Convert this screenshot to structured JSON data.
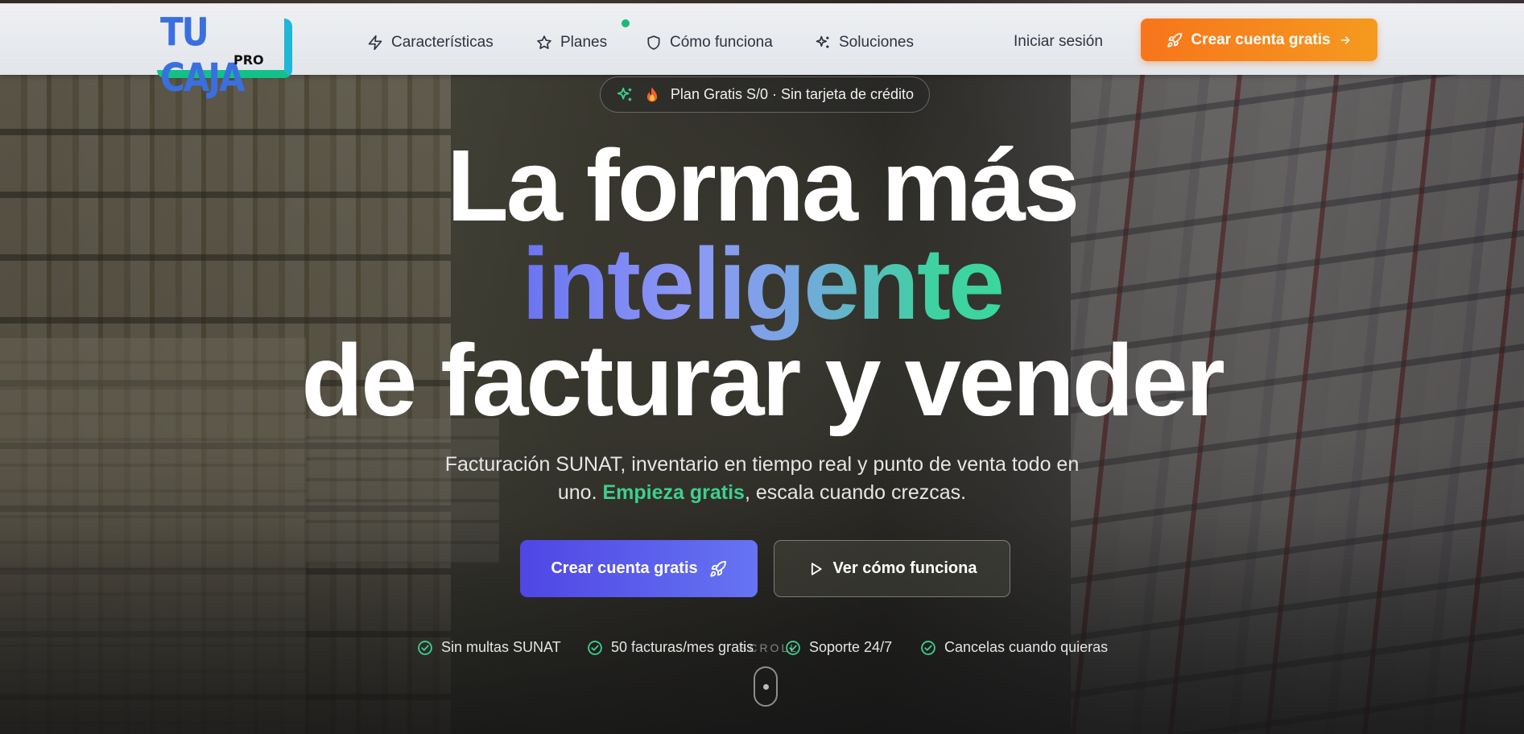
{
  "brand": {
    "logo_main": "TU CAJA",
    "logo_sub": "PRO",
    "colors": {
      "logo_blue": "#3a6fe0",
      "logo_cyan": "#1fb6d9",
      "logo_green": "#12c08a"
    }
  },
  "nav": {
    "items": [
      {
        "label": "Características",
        "icon": "zap-icon"
      },
      {
        "label": "Planes",
        "icon": "star-icon"
      },
      {
        "label": "Cómo funciona",
        "icon": "shield-icon"
      },
      {
        "label": "Soluciones",
        "icon": "sparkles-icon"
      }
    ],
    "login_label": "Iniciar sesión",
    "cta_label": "Crear cuenta gratis",
    "cta_color": "#f7751c"
  },
  "hero": {
    "badge": "Plan Gratis S/0 · Sin tarjeta de crédito",
    "title_line1": "La forma más",
    "title_highlight": "inteligente",
    "title_line3": "de facturar y vender",
    "subtitle_part1": "Facturación SUNAT, inventario en tiempo real y punto de venta todo en",
    "subtitle_part2": "uno.",
    "subtitle_highlight": "Empieza gratis",
    "subtitle_part3": ", escala cuando crezcas.",
    "primary_button": "Crear cuenta gratis",
    "secondary_button": "Ver cómo funciona",
    "accent_indigo": "#4f46e5",
    "accent_green": "#3ecf8e",
    "checks": [
      "Sin multas SUNAT",
      "50 facturas/mes gratis",
      "Soporte 24/7",
      "Cancelas cuando quieras"
    ],
    "scroll_label": "SCROLL"
  }
}
